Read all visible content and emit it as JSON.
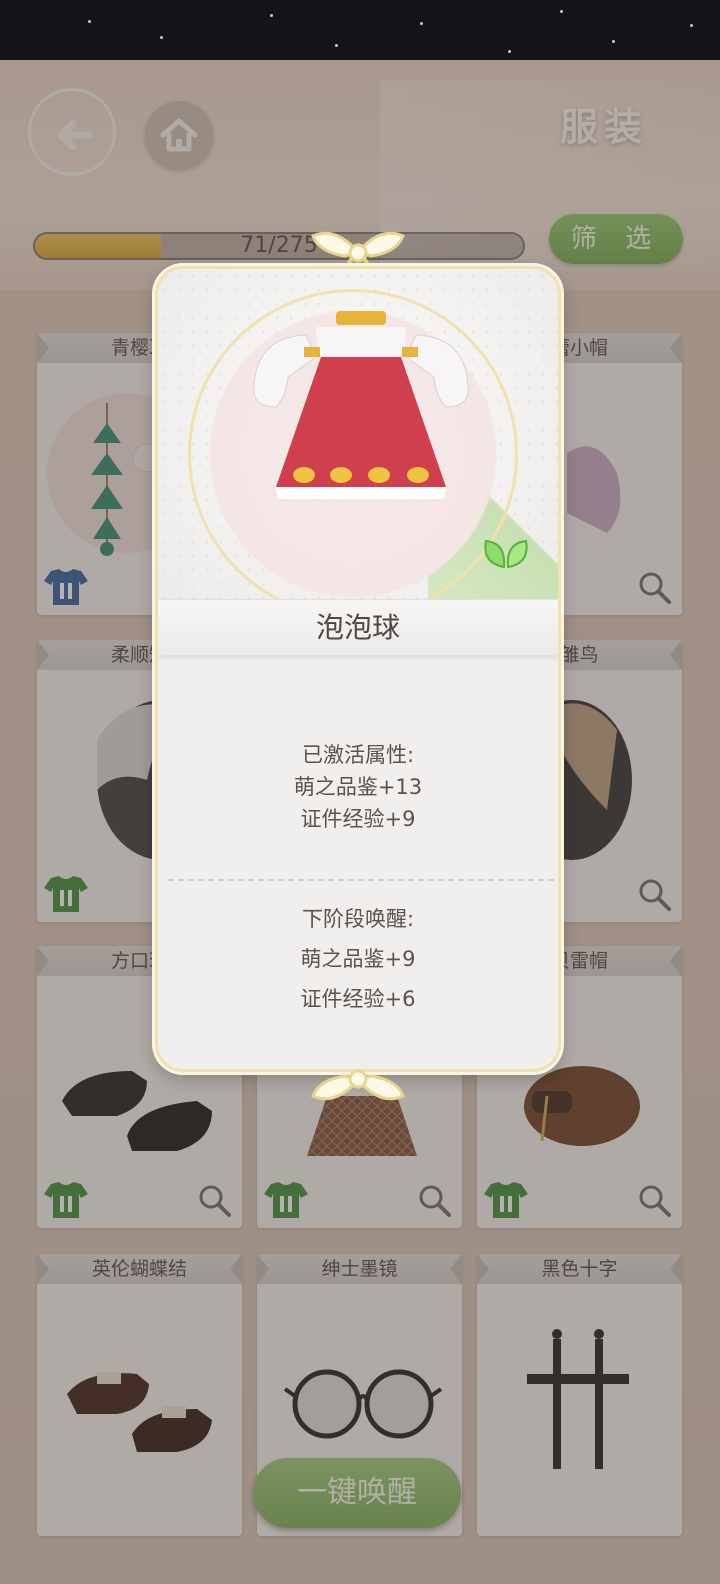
{
  "header": {
    "title": "服装",
    "progress_text": "71/275",
    "progress_fraction": 0.258,
    "filter_label": "筛 选"
  },
  "grid": {
    "rows": [
      [
        "青樱耳",
        "",
        "蕾小帽"
      ],
      [
        "柔顺短",
        "",
        "雏鸟"
      ],
      [
        "方口玛",
        "",
        "贝雷帽"
      ],
      [
        "英伦蝴蝶结",
        "绅士墨镜",
        "黑色十字"
      ]
    ]
  },
  "modal": {
    "item_name": "泡泡球",
    "activated_heading": "已激活属性:",
    "activated_attrs": [
      "萌之品鉴+13",
      "证件经验+9"
    ],
    "next_heading": "下阶段唤醒:",
    "next_attrs": [
      "萌之品鉴+9",
      "证件经验+6"
    ]
  },
  "bottom_button": "一键唤醒",
  "colors": {
    "accent_green": "#7aae55",
    "progress_gold": "#d9a234",
    "frame_gold": "#efe2b2",
    "dress_red": "#cf3f4d"
  },
  "icons": [
    "back-arrow-icon",
    "home-icon",
    "wear-shirt-icon",
    "magnifier-icon",
    "bow-icon",
    "leaf-icon"
  ]
}
